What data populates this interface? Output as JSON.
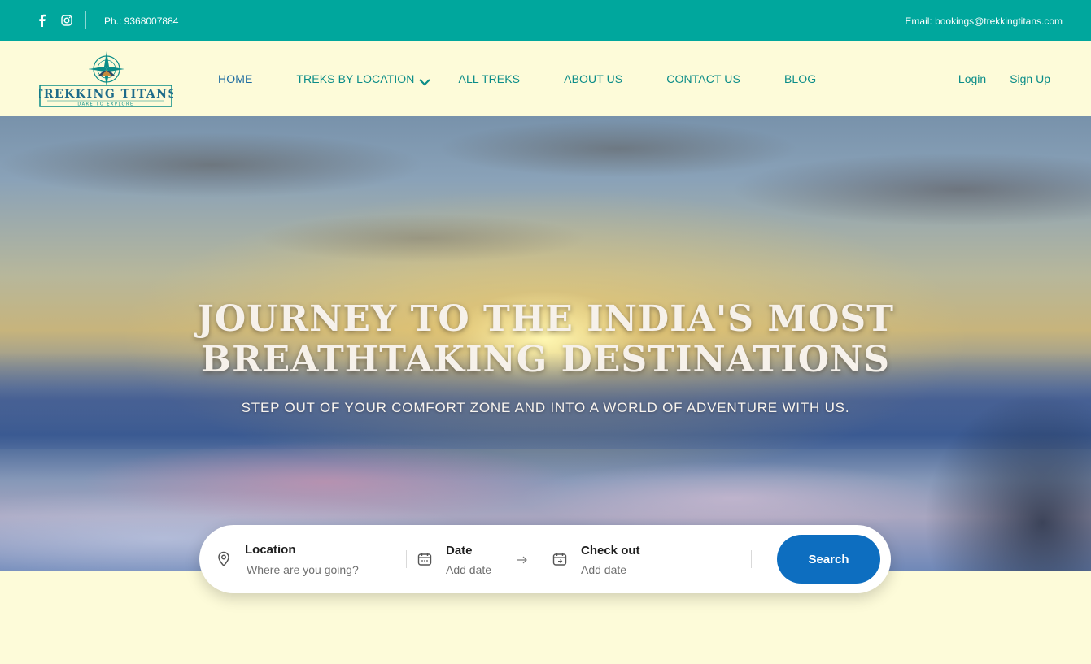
{
  "topbar": {
    "social": [
      "facebook-icon",
      "instagram-icon"
    ],
    "phone": "Ph.: 9368007884",
    "email": "Email: bookings@trekkingtitans.com"
  },
  "logo": {
    "name": "TREKKING TITANS",
    "tagline": "DARE TO EXPLORE"
  },
  "nav": {
    "items": [
      "HOME",
      "TREKS BY LOCATION",
      "ALL TREKS",
      "ABOUT US",
      "CONTACT US",
      "BLOG"
    ],
    "login": "Login",
    "signup": "Sign Up"
  },
  "hero": {
    "headline_line1": "JOURNEY TO THE INDIA'S MOST",
    "headline_line2": "BREATHTAKING DESTINATIONS",
    "subline": "STEP OUT OF YOUR COMFORT ZONE AND INTO A WORLD OF ADVENTURE WITH US."
  },
  "search": {
    "location_label": "Location",
    "location_placeholder": "Where are you going?",
    "date_label": "Date",
    "date_placeholder": "Add date",
    "checkout_label": "Check out",
    "checkout_placeholder": "Add date",
    "button": "Search"
  },
  "colors": {
    "topbar": "#00a79d",
    "nav_bg": "#fdfbd9",
    "nav_link": "#0a8c88",
    "nav_active": "#1a6aa0",
    "search_button": "#0d6ec0"
  }
}
